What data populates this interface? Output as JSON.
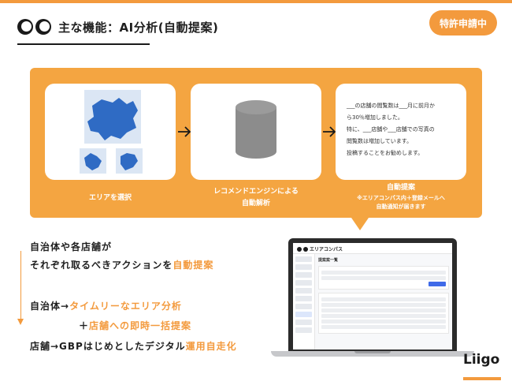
{
  "header": {
    "title": "主な機能：AI分析(自動提案)",
    "badge": "特許申請中"
  },
  "flow": {
    "step1_caption": "エリアを選択",
    "step2_caption_line1": "レコメンドエンジンによる",
    "step2_caption_line2": "自動解析",
    "step3_caption": "自動提案",
    "step3_note_line1": "※エリアコンパス内＋登録メールへ",
    "step3_note_line2": "自動通知が届きます",
    "proposal_lines": [
      "___の店舗の閲覧数は___月に前月か",
      "ら30％増加しました。",
      "特に、___店舗や___店舗での写真の",
      "閲覧数は増加しています。",
      "投稿することをお勧めします。"
    ]
  },
  "features": {
    "line1": "自治体や各店舗が",
    "line2_prefix": "それぞれ取るべきアクションを",
    "line2_highlight": "自動提案",
    "line3_prefix": "自治体→",
    "line3_highlight": "タイムリーなエリア分析",
    "line4_prefix": "＋",
    "line4_highlight": "店舗への即時一括提案",
    "line5_prefix": "店舗→GBPはじめとしたデジタル",
    "line5_highlight": "運用自走化"
  },
  "app": {
    "name": "エリアコンパス",
    "page_heading": "提案案一覧"
  },
  "brand": {
    "name": "Liigo"
  },
  "colors": {
    "accent": "#f39a3d",
    "panel": "#f4a541",
    "map": "#2f6bc4"
  }
}
